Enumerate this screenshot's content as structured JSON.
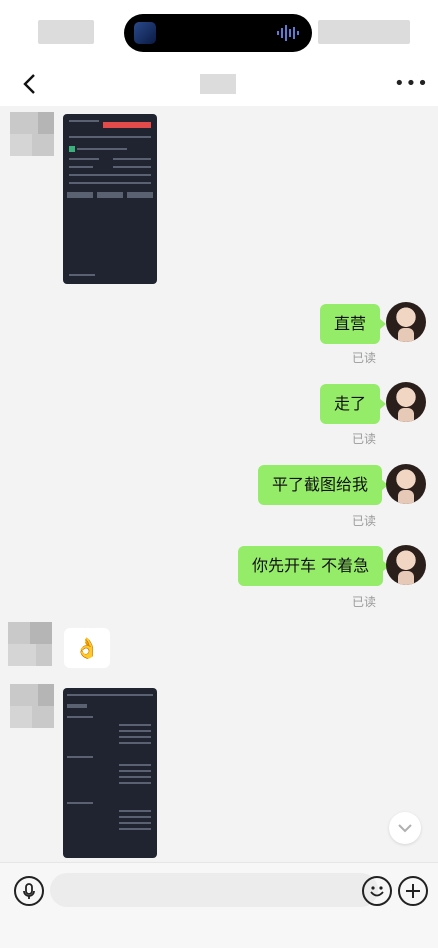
{
  "chat": {
    "messages": [
      {
        "type": "image",
        "from": "other"
      },
      {
        "type": "text",
        "from": "me",
        "text": "直营",
        "read": "已读"
      },
      {
        "type": "text",
        "from": "me",
        "text": "走了",
        "read": "已读"
      },
      {
        "type": "text",
        "from": "me",
        "text": "平了截图给我",
        "read": "已读"
      },
      {
        "type": "text",
        "from": "me",
        "text": "你先开车 不着急",
        "read": "已读"
      },
      {
        "type": "emoji",
        "from": "other",
        "text": "👌"
      },
      {
        "type": "image",
        "from": "other"
      }
    ]
  },
  "icons": {
    "back": "chevron-left-icon",
    "more": "more-dots-icon",
    "voice": "microphone-icon",
    "emoji": "smiley-icon",
    "add": "plus-icon",
    "scroll": "chevron-down-icon"
  },
  "colors": {
    "my_bubble": "#95ec69",
    "background": "#f3f3f3",
    "read_text": "#9a9a9a"
  },
  "input": {
    "value": ""
  }
}
